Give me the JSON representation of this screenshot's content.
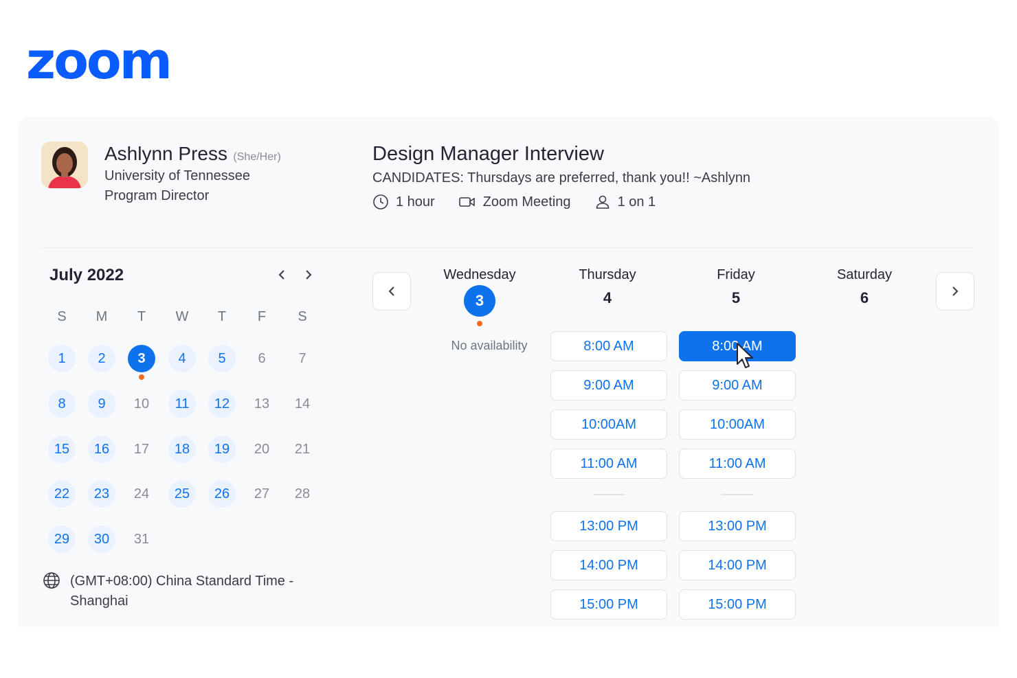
{
  "brand": {
    "logo_text": "zoom",
    "color": "#0b5cff"
  },
  "host": {
    "name": "Ashlynn Press",
    "pronouns": "(She/Her)",
    "organization": "University of Tennessee",
    "role": "Program Director"
  },
  "event": {
    "title": "Design Manager Interview",
    "description": "CANDIDATES: Thursdays are preferred, thank you!! ~Ashlynn",
    "duration": "1 hour",
    "location": "Zoom Meeting",
    "type": "1 on 1"
  },
  "calendar": {
    "month_label": "July 2022",
    "prev_icon": "chevron-left-icon",
    "next_icon": "chevron-right-icon",
    "weekdays": [
      "S",
      "M",
      "T",
      "W",
      "T",
      "F",
      "S"
    ],
    "weeks": [
      [
        {
          "d": "1",
          "s": "avail"
        },
        {
          "d": "2",
          "s": "avail"
        },
        {
          "d": "3",
          "s": "sel",
          "dot": true
        },
        {
          "d": "4",
          "s": "avail"
        },
        {
          "d": "5",
          "s": "avail"
        },
        {
          "d": "6",
          "s": "na"
        },
        {
          "d": "7",
          "s": "na"
        }
      ],
      [
        {
          "d": "8",
          "s": "avail"
        },
        {
          "d": "9",
          "s": "avail"
        },
        {
          "d": "10",
          "s": "na"
        },
        {
          "d": "11",
          "s": "avail"
        },
        {
          "d": "12",
          "s": "avail"
        },
        {
          "d": "13",
          "s": "na"
        },
        {
          "d": "14",
          "s": "na"
        }
      ],
      [
        {
          "d": "15",
          "s": "avail"
        },
        {
          "d": "16",
          "s": "avail"
        },
        {
          "d": "17",
          "s": "na"
        },
        {
          "d": "18",
          "s": "avail"
        },
        {
          "d": "19",
          "s": "avail"
        },
        {
          "d": "20",
          "s": "na"
        },
        {
          "d": "21",
          "s": "na"
        }
      ],
      [
        {
          "d": "22",
          "s": "avail"
        },
        {
          "d": "23",
          "s": "avail"
        },
        {
          "d": "24",
          "s": "na"
        },
        {
          "d": "25",
          "s": "avail"
        },
        {
          "d": "26",
          "s": "avail"
        },
        {
          "d": "27",
          "s": "na"
        },
        {
          "d": "28",
          "s": "na"
        }
      ],
      [
        {
          "d": "29",
          "s": "avail"
        },
        {
          "d": "30",
          "s": "avail"
        },
        {
          "d": "31",
          "s": "na"
        }
      ]
    ]
  },
  "timezone": {
    "label": "(GMT+08:00) China Standard Time - Shanghai"
  },
  "schedule": {
    "days": [
      {
        "name": "Wednesday",
        "number": "3",
        "selected": true
      },
      {
        "name": "Thursday",
        "number": "4",
        "selected": false
      },
      {
        "name": "Friday",
        "number": "5",
        "selected": false
      },
      {
        "name": "Saturday",
        "number": "6",
        "selected": false
      }
    ],
    "no_availability": "No availability",
    "thursday_slots": [
      "8:00 AM",
      "9:00 AM",
      "10:00AM",
      "11:00 AM",
      "13:00 PM",
      "14:00 PM",
      "15:00 PM"
    ],
    "friday_slots": [
      "8:00 AM",
      "9:00 AM",
      "10:00AM",
      "11:00 AM",
      "13:00 PM",
      "14:00 PM",
      "15:00 PM"
    ],
    "selected_slot": "Friday 8:00 AM"
  },
  "colors": {
    "accent": "#0e72ed",
    "dot": "#f26d21",
    "available_bg": "#eaf2ff"
  }
}
